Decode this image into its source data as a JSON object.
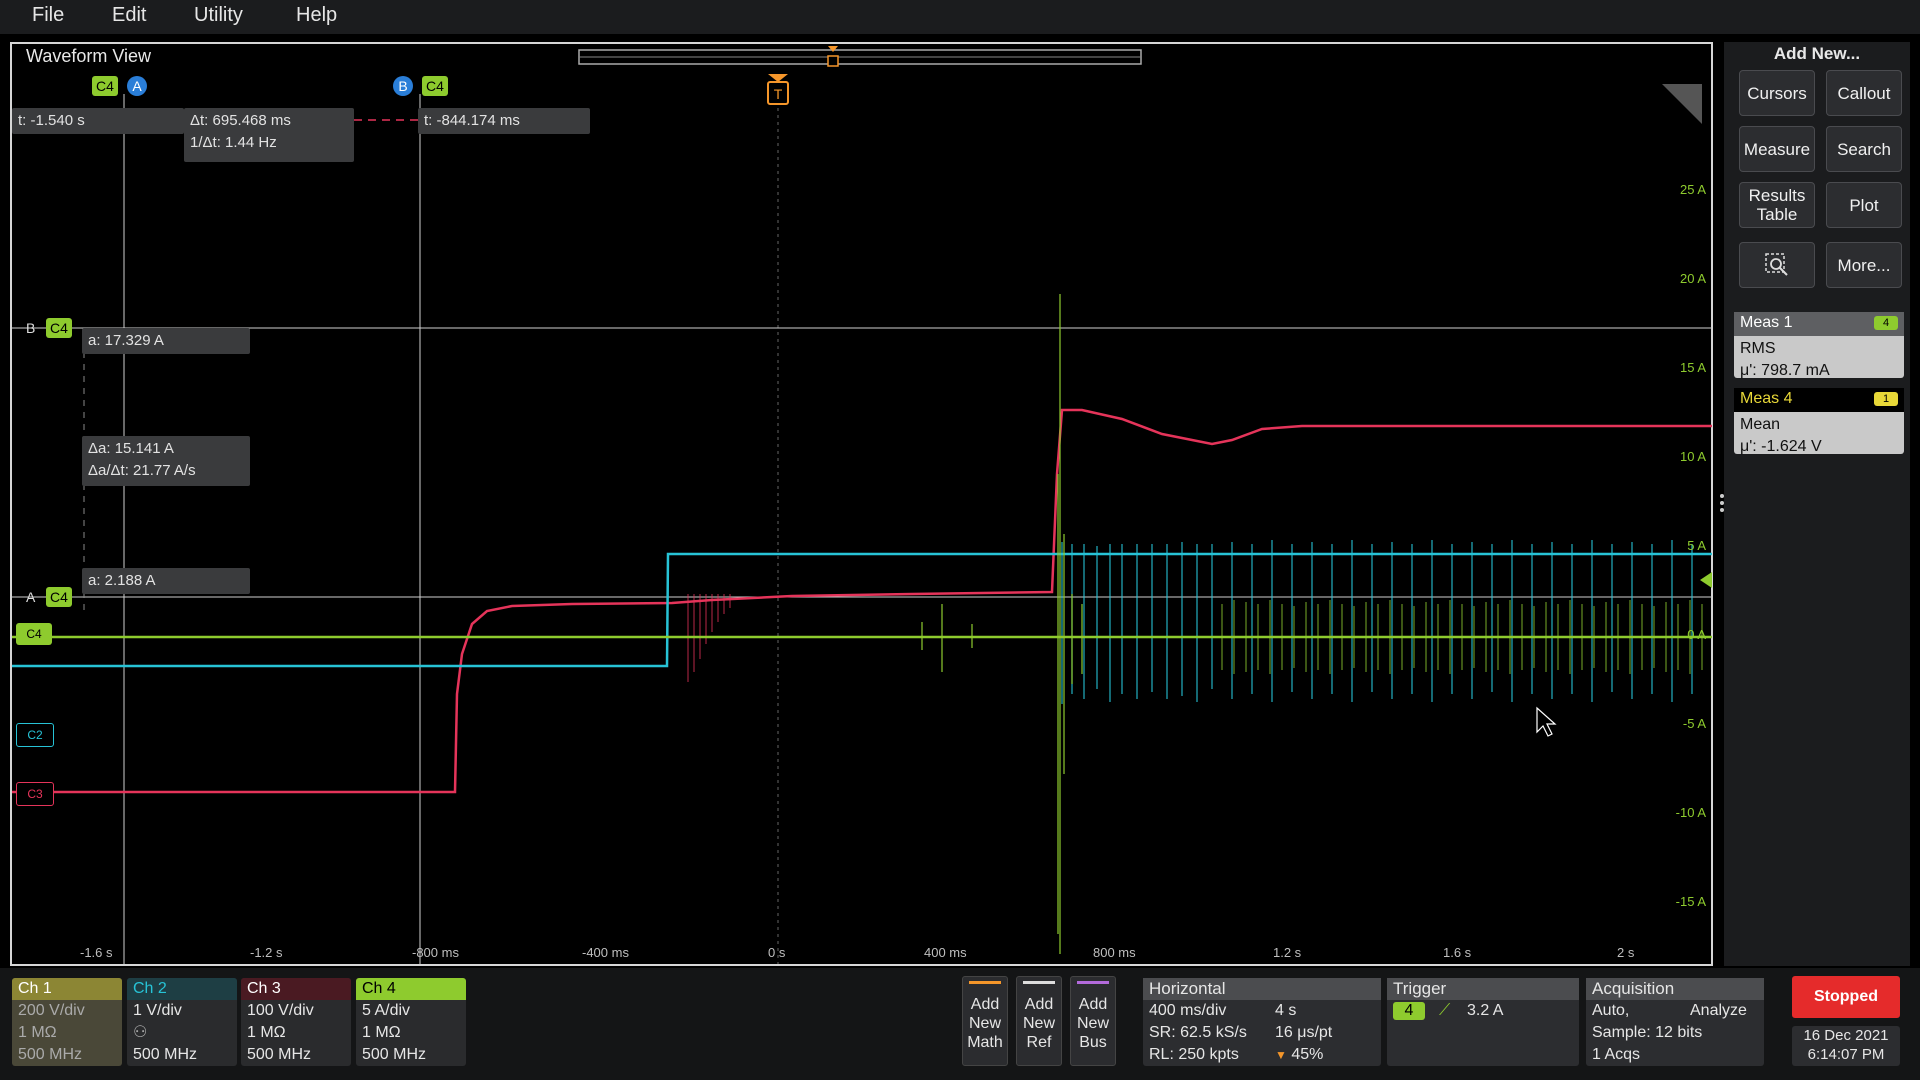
{
  "menu": {
    "file": "File",
    "edit": "Edit",
    "utility": "Utility",
    "help": "Help"
  },
  "waveform": {
    "title": "Waveform View",
    "trigger_marker": "T",
    "cursors": {
      "a_badge": "A",
      "b_badge": "B",
      "c4_badge": "C4",
      "t_a": "t: -1.540 s",
      "delta_t": "Δt: 695.468 ms",
      "inv_delta_t": "1/Δt: 1.44 Hz",
      "t_b": "t: -844.174 ms",
      "a_b_value": "a: 17.329 A",
      "delta_a": "Δa: 15.141 A",
      "delta_a_dt": "Δa/Δt: 21.77 A/s",
      "a_a_value": "a: 2.188 A"
    },
    "x_ticks": [
      "-1.6 s",
      "-1.2 s",
      "-800 ms",
      "-400 ms",
      "0 s",
      "400 ms",
      "800 ms",
      "1.2 s",
      "1.6 s",
      "2 s"
    ],
    "y_ticks": [
      "25 A",
      "20 A",
      "15 A",
      "10 A",
      "5 A",
      "0 A",
      "-5 A",
      "-10 A",
      "-15 A"
    ],
    "channel_tags": {
      "c4": "C4",
      "c2": "C2",
      "c3": "C3"
    }
  },
  "right_panel": {
    "title": "Add New...",
    "buttons": {
      "cursors": "Cursors",
      "callout": "Callout",
      "measure": "Measure",
      "search": "Search",
      "results_line1": "Results",
      "results_line2": "Table",
      "plot": "Plot",
      "more": "More..."
    },
    "meas1": {
      "title": "Meas 1",
      "badge": "4",
      "type": "RMS",
      "value": "μ': 798.7 mA"
    },
    "meas4": {
      "title": "Meas 4",
      "badge": "1",
      "type": "Mean",
      "value": "μ': -1.624 V"
    }
  },
  "channels": [
    {
      "name": "Ch 1",
      "scale": "200 V/div",
      "imp": "1 MΩ",
      "bw": "500 MHz"
    },
    {
      "name": "Ch 2",
      "scale": "1 V/div",
      "imp": "",
      "bw": "500 MHz"
    },
    {
      "name": "Ch 3",
      "scale": "100 V/div",
      "imp": "1 MΩ",
      "bw": "500 MHz"
    },
    {
      "name": "Ch 4",
      "scale": "5 A/div",
      "imp": "1 MΩ",
      "bw": "500 MHz"
    }
  ],
  "add_buttons": {
    "math": [
      "Add",
      "New",
      "Math"
    ],
    "ref": [
      "Add",
      "New",
      "Ref"
    ],
    "bus": [
      "Add",
      "New",
      "Bus"
    ]
  },
  "horizontal": {
    "title": "Horizontal",
    "scale": "400 ms/div",
    "duration": "4 s",
    "sr": "SR: 62.5 kS/s",
    "pt": "16 μs/pt",
    "rl": "RL: 250 kpts",
    "pos": "45%"
  },
  "trigger": {
    "title": "Trigger",
    "source": "4",
    "level": "3.2 A"
  },
  "acquisition": {
    "title": "Acquisition",
    "mode": "Auto,",
    "analyze": "Analyze",
    "sample": "Sample: 12 bits",
    "acqs": "1 Acqs"
  },
  "status": {
    "run": "Stopped",
    "date": "16 Dec 2021",
    "time": "6:14:07 PM"
  },
  "colors": {
    "ch1": "#c9c23a",
    "ch2": "#27c3d6",
    "ch3": "#e5345a",
    "ch4": "#8ecb2e",
    "stopped": "#e52b2b",
    "trigger": "#f5962a"
  }
}
